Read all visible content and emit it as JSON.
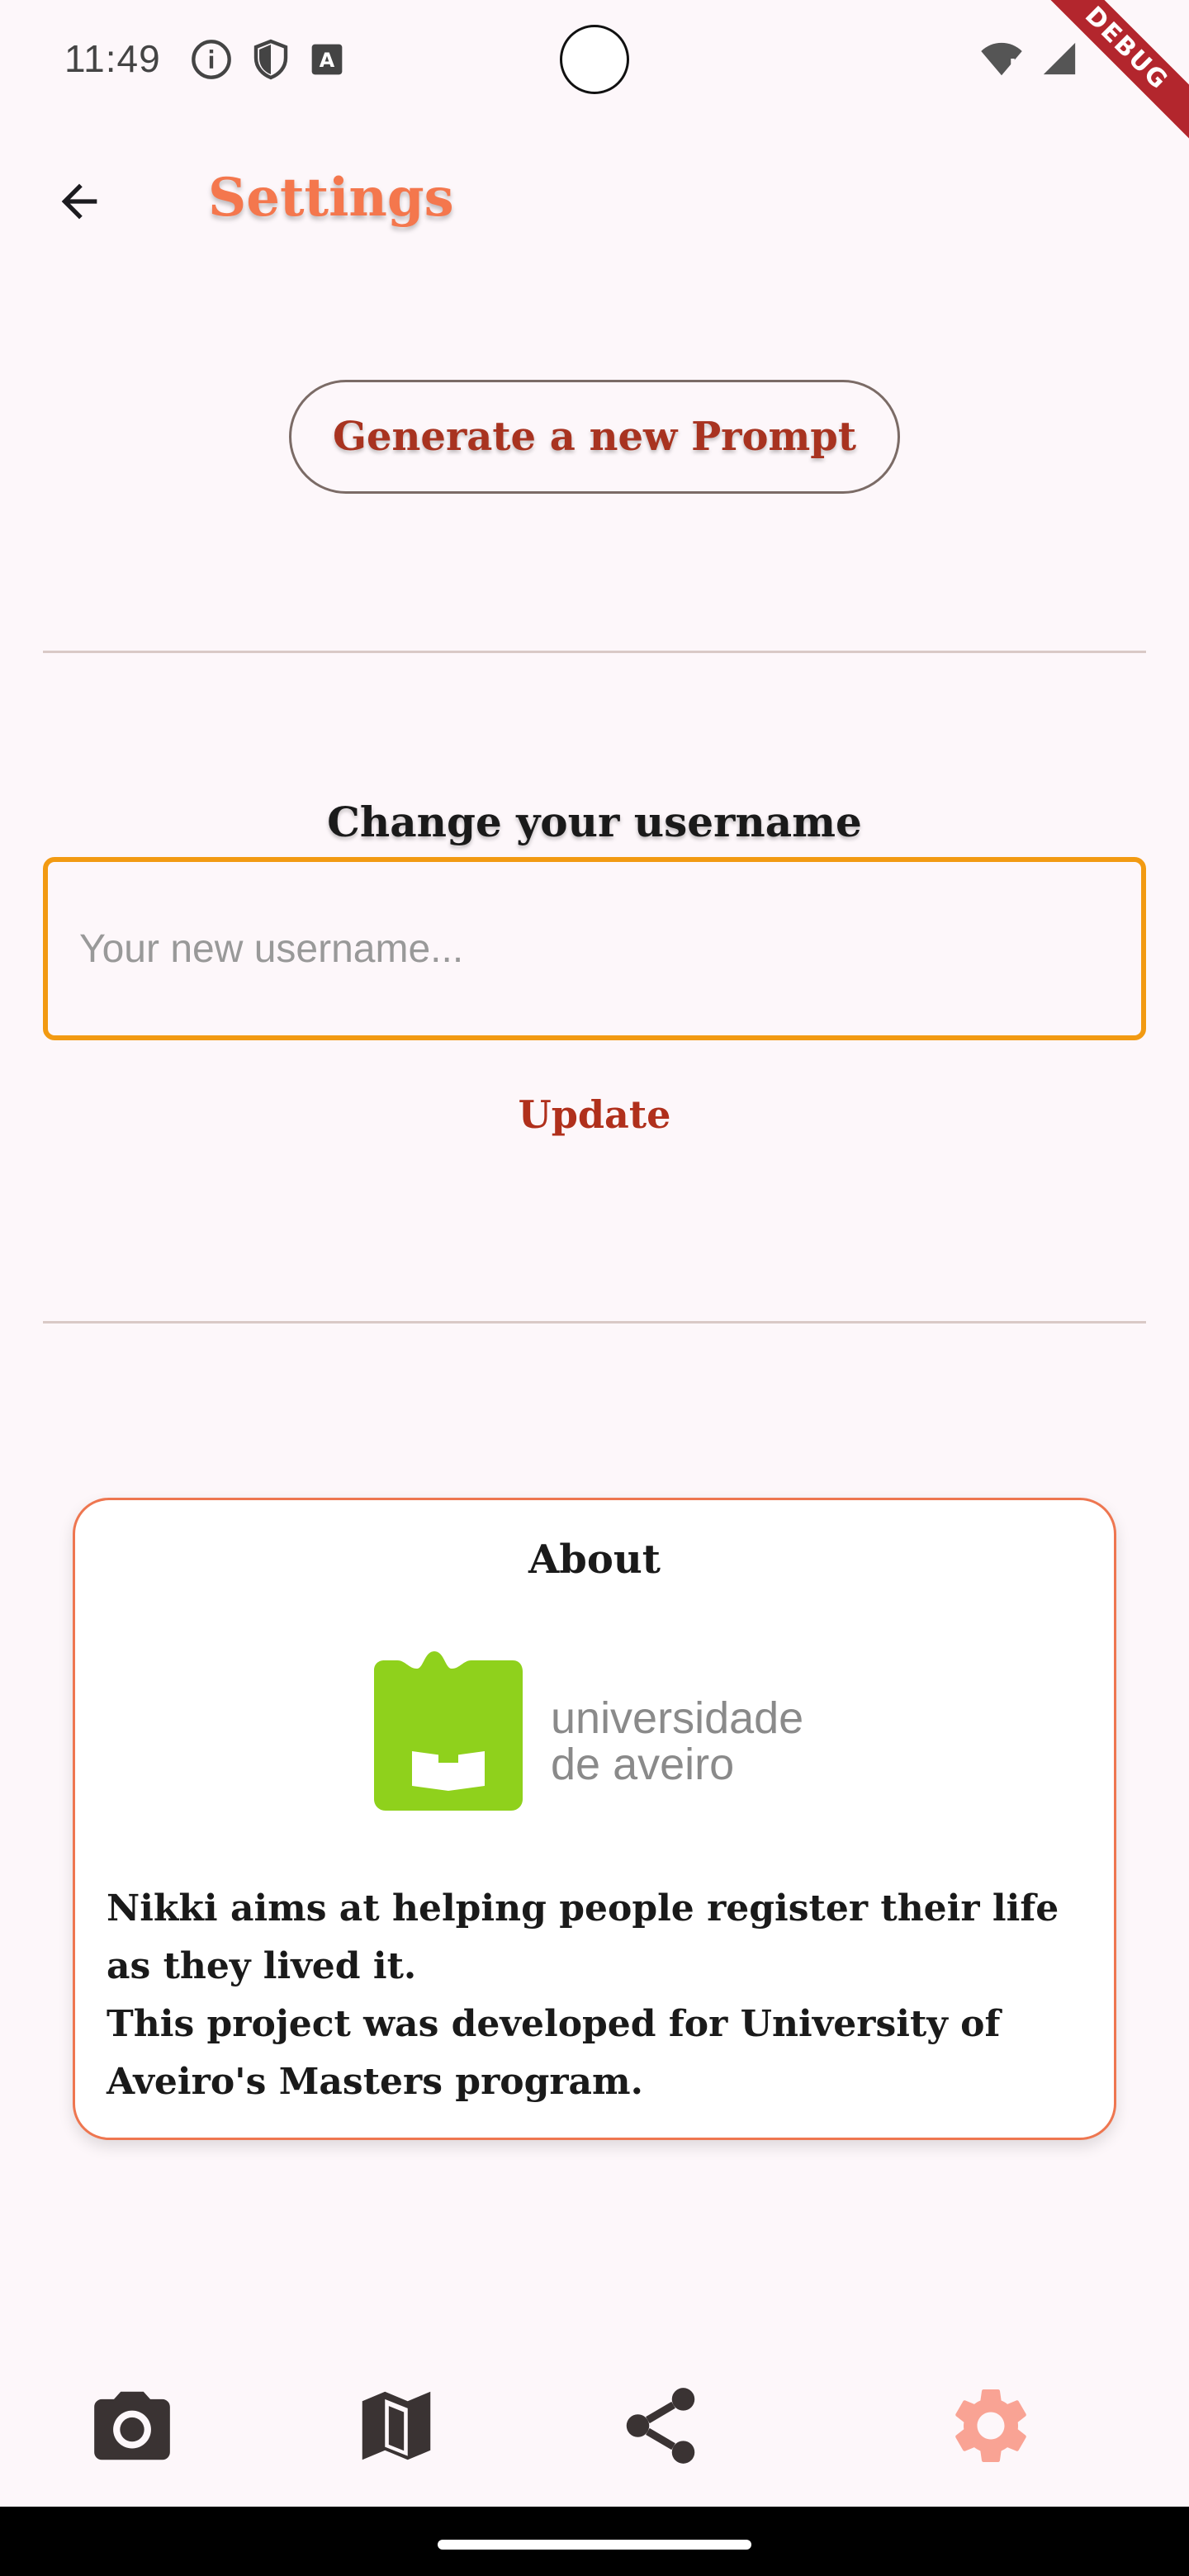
{
  "status_bar": {
    "time": "11:49",
    "left_icons": [
      "info-icon",
      "shield-icon",
      "text-a-icon"
    ],
    "right_icons": [
      "wifi-icon",
      "signal-icon"
    ],
    "debug_label": "DEBUG"
  },
  "app_bar": {
    "title": "Settings",
    "back_icon": "arrow-back-icon"
  },
  "prompt": {
    "button_label": "Generate a new Prompt"
  },
  "username": {
    "heading": "Change your username",
    "placeholder": "Your new username...",
    "value": "",
    "update_label": "Update"
  },
  "about": {
    "title": "About",
    "logo_text_line1": "universidade",
    "logo_text_line2": "de aveiro",
    "paragraph1": "Nikki aims at helping people register their life as they lived it.",
    "paragraph2": "This project was developed for University of Aveiro's Masters program."
  },
  "bottom_nav": {
    "items": [
      "camera-icon",
      "map-icon",
      "share-icon",
      "settings-icon"
    ],
    "active": "settings-icon"
  },
  "colors": {
    "accent": "#f4774d",
    "button_text": "#a83320",
    "input_border": "#f29a12",
    "card_border": "#ee7650",
    "logo_green": "#8fd11c",
    "nav_active": "#f9a394",
    "nav_inactive": "#3a3333",
    "debug_banner": "#b3262d"
  }
}
